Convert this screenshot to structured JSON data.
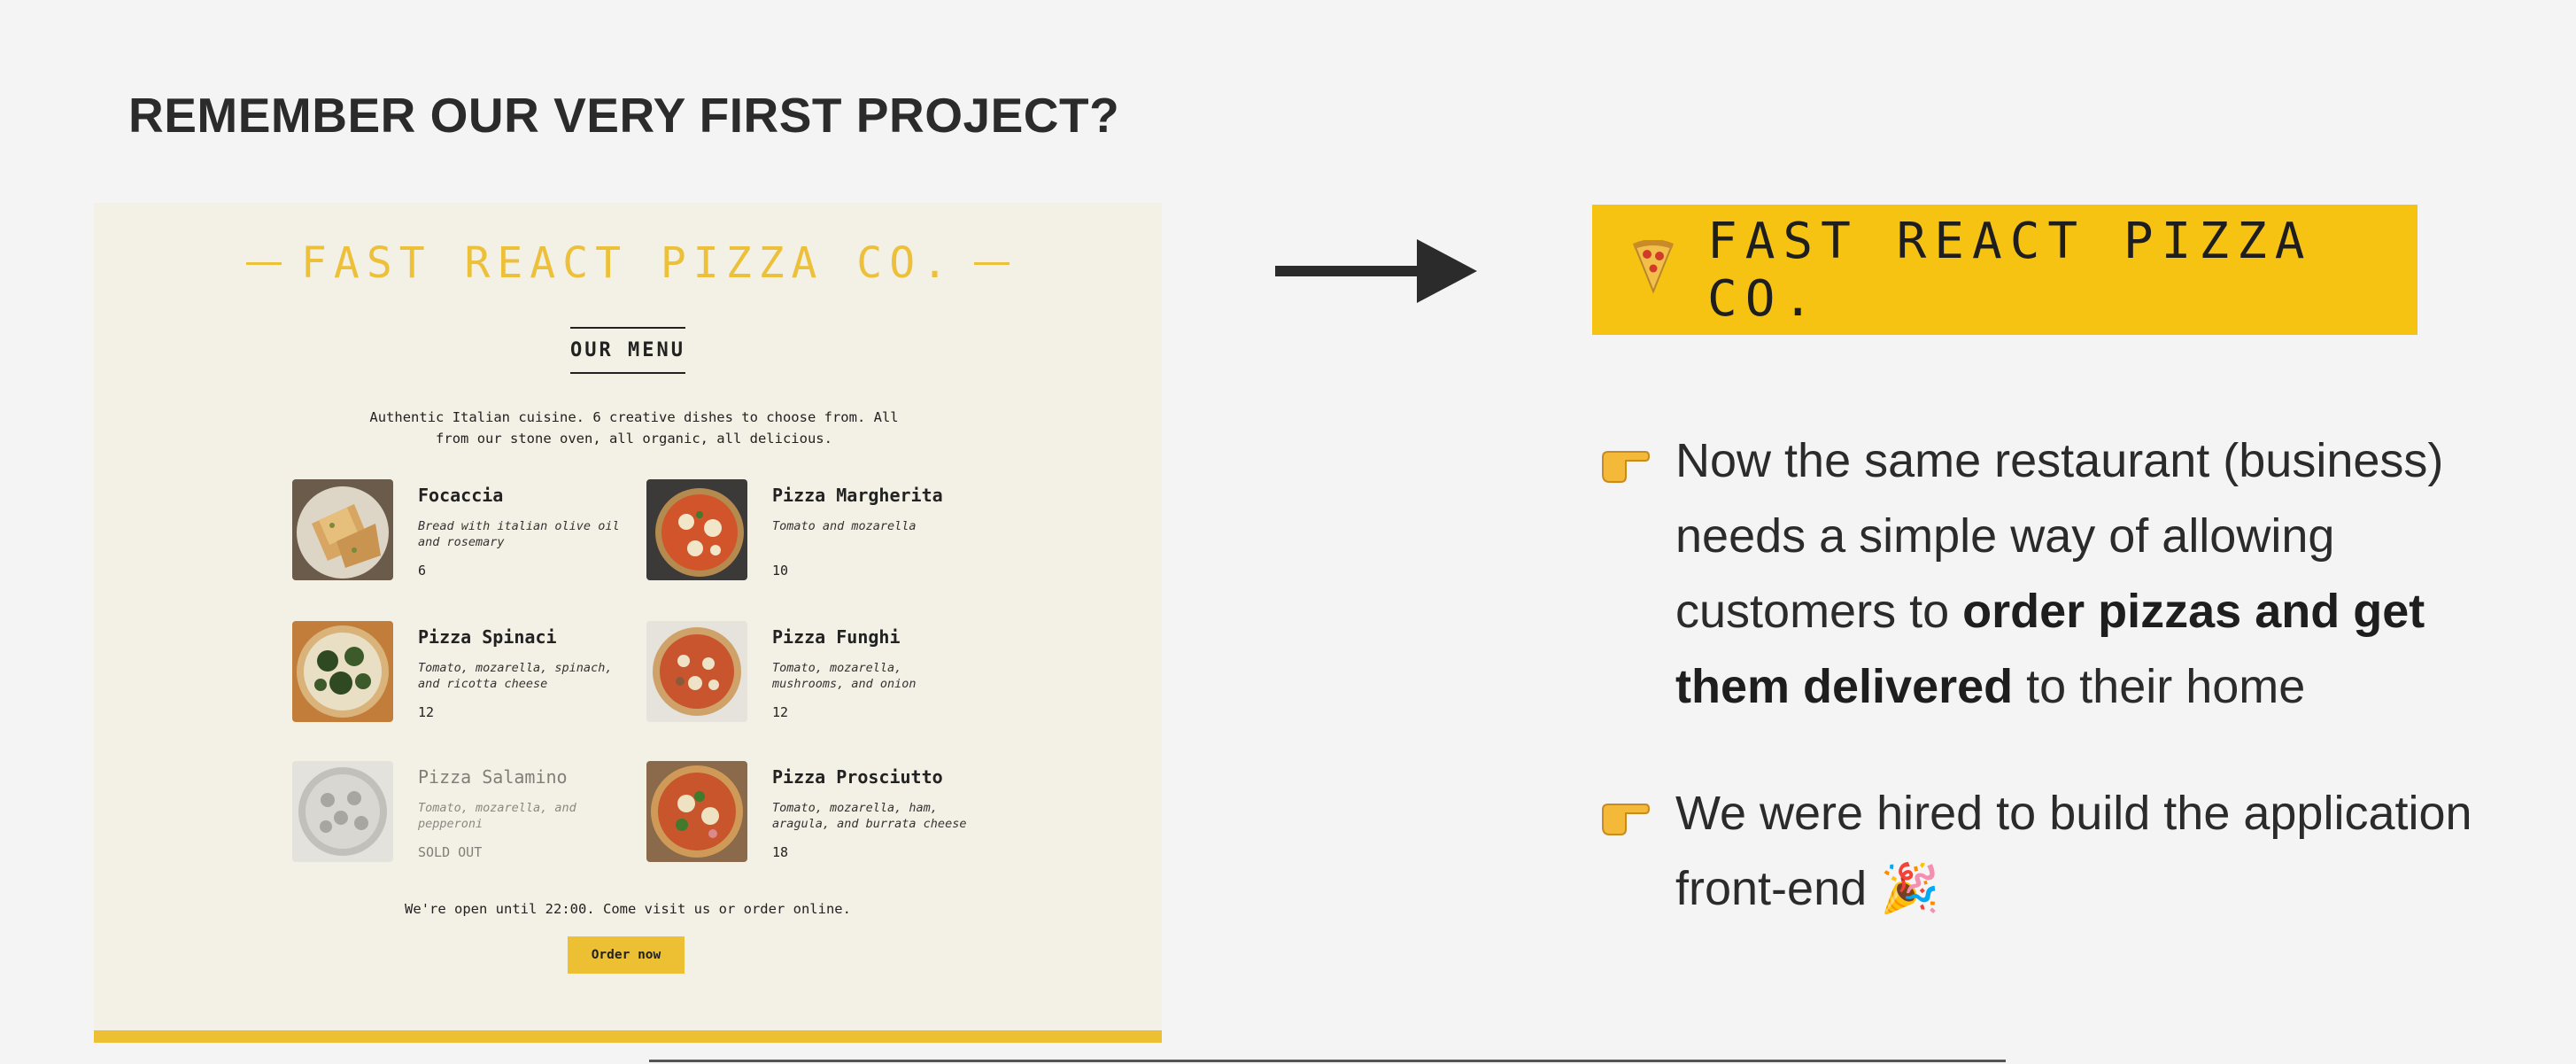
{
  "slide": {
    "title": "REMEMBER OUR VERY FIRST PROJECT?"
  },
  "old_project": {
    "brand_title": "FAST REACT PIZZA CO.",
    "menu_heading": "OUR MENU",
    "intro": "Authentic Italian cuisine. 6 creative dishes to choose from. All from our stone oven, all organic, all delicious.",
    "pizzas": [
      {
        "name": "Focaccia",
        "ingredients": "Bread with italian olive oil and rosemary",
        "price": "6",
        "sold_out": false
      },
      {
        "name": "Pizza Margherita",
        "ingredients": "Tomato and mozarella",
        "price": "10",
        "sold_out": false
      },
      {
        "name": "Pizza Spinaci",
        "ingredients": "Tomato, mozarella, spinach, and ricotta cheese",
        "price": "12",
        "sold_out": false
      },
      {
        "name": "Pizza Funghi",
        "ingredients": "Tomato, mozarella, mushrooms, and onion",
        "price": "12",
        "sold_out": false
      },
      {
        "name": "Pizza Salamino",
        "ingredients": "Tomato, mozarella, and pepperoni",
        "price": "SOLD OUT",
        "sold_out": true
      },
      {
        "name": "Pizza Prosciutto",
        "ingredients": "Tomato, mozarella, ham, aragula, and burrata cheese",
        "price": "18",
        "sold_out": false
      }
    ],
    "footer": "We're open until 22:00. Come visit us or order online.",
    "order_button": "Order now",
    "colors": {
      "accent": "#edc03a",
      "background": "#f3f0e5"
    }
  },
  "new_project": {
    "brand_icon": "pizza-icon",
    "brand_title": "FAST REACT PIZZA CO.",
    "bullet_icon": "pointing-hand-icon",
    "bullets": [
      {
        "text_a": "Now the same restaurant (business) needs a simple way of allowing customers to ",
        "bold": "order pizzas and get them delivered",
        "text_b": " to their home"
      },
      {
        "text_a": "We were hired to build the application front-end",
        "emoji": "🎉"
      }
    ],
    "colors": {
      "brand_bg": "#f7c313"
    }
  }
}
